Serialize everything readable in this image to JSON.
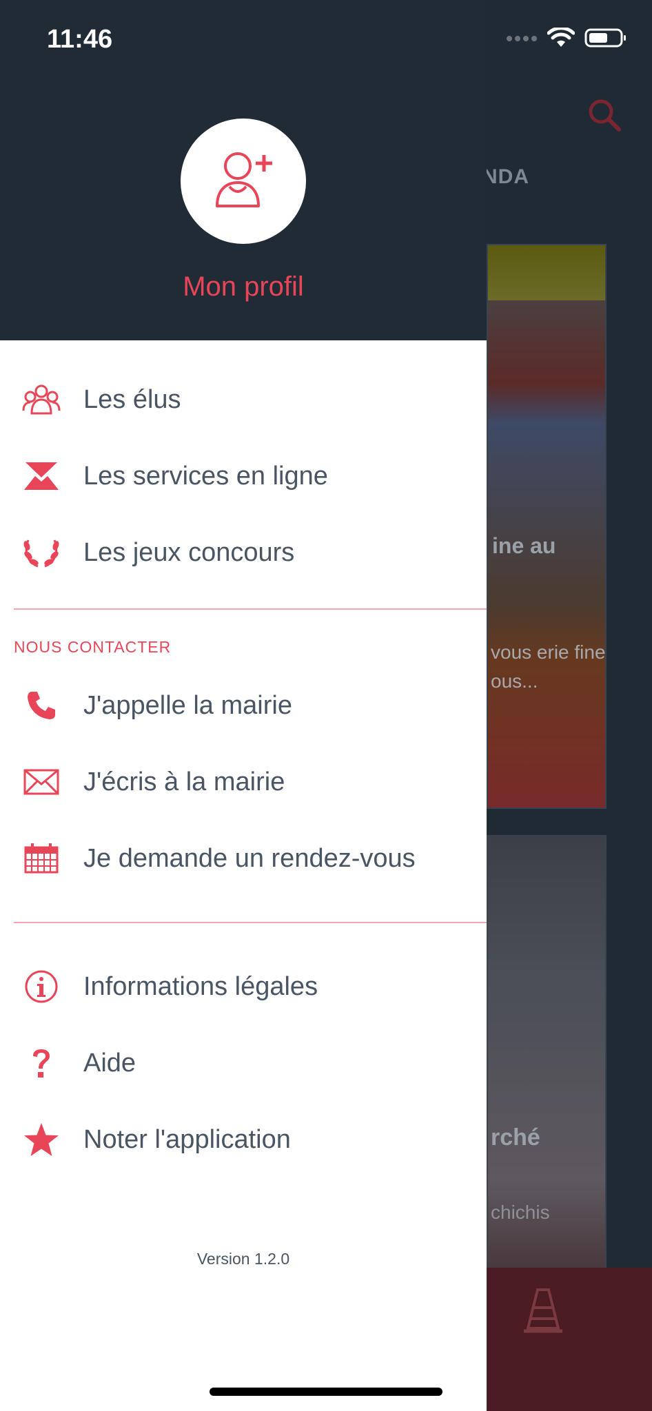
{
  "status_bar": {
    "time": "11:46"
  },
  "drawer": {
    "profile": {
      "label": "Mon profil",
      "icon": "add-user-icon"
    },
    "menu_top": [
      {
        "label": "Les élus",
        "icon": "people-icon"
      },
      {
        "label": "Les services en ligne",
        "icon": "services-icon"
      },
      {
        "label": "Les jeux concours",
        "icon": "laurel-icon"
      }
    ],
    "contact_section_title": "NOUS CONTACTER",
    "menu_contact": [
      {
        "label": "J'appelle la mairie",
        "icon": "phone-icon"
      },
      {
        "label": "J'écris à la mairie",
        "icon": "envelope-icon"
      },
      {
        "label": "Je demande un rendez-vous",
        "icon": "calendar-icon"
      }
    ],
    "menu_bottom": [
      {
        "label": "Informations légales",
        "icon": "info-icon"
      },
      {
        "label": "Aide",
        "icon": "help-icon"
      },
      {
        "label": "Noter l'application",
        "icon": "star-icon"
      }
    ],
    "version": "Version 1.2.0"
  },
  "background_app": {
    "tab_fragment": "NDA",
    "card1": {
      "title_fragment": "ine au",
      "text_fragment": "vous erie fine ous..."
    },
    "card2": {
      "title_fragment": "rché",
      "text_fragment": "chichis"
    }
  },
  "colors": {
    "accent": "#e84658",
    "header_bg": "#212b35",
    "text": "#4a5563",
    "divider": "#f2a6ae"
  }
}
